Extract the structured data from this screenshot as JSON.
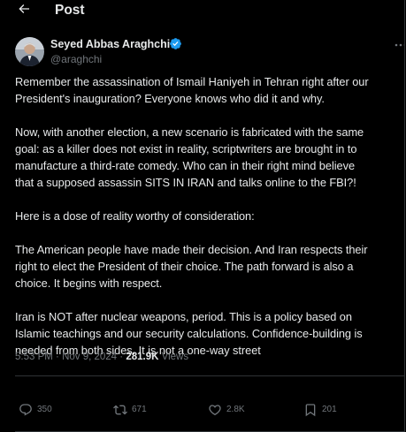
{
  "header": {
    "title": "Post"
  },
  "author": {
    "name": "Seyed Abbas Araghchi",
    "handle": "@araghchi"
  },
  "tweet": {
    "paragraphs": [
      [
        "Remember the assassination of Ismail Haniyeh in Tehran right after our",
        "President's inauguration? Everyone knows who did it and why."
      ],
      [
        "Now, with another election, a new scenario is fabricated with the same",
        "goal: as a killer does not exist in reality, scriptwriters are brought in to",
        "manufacture a third-rate comedy. Who can in their right mind believe",
        "that a supposed assassin SITS IN IRAN and talks online to the FBI?!"
      ],
      [
        "Here is a dose of reality worthy of consideration:"
      ],
      [
        "The American people have made their decision. And Iran respects their",
        "right to elect the President of their choice. The path forward is also a",
        "choice. It begins with respect."
      ],
      [
        "Iran is NOT after nuclear weapons, period. This is a policy based on",
        "Islamic teachings and our security calculations. Confidence-building is",
        "needed from both sides. It is not a one-way street"
      ]
    ]
  },
  "meta": {
    "time": "5:53 PM",
    "separator": " · ",
    "date": "Nov 9, 2024",
    "views_count": "281.9K",
    "views_label": "Views"
  },
  "actions": {
    "replies": "350",
    "reposts": "671",
    "likes": "2.8K",
    "bookmarks": "201"
  },
  "colors": {
    "background": "#000000",
    "text": "#e7e9ea",
    "muted": "#71767b",
    "border": "#2f3336",
    "verified": "#1d9bf0"
  },
  "icons": {
    "back": "arrow-left-icon",
    "verified": "verified-badge-icon",
    "more": "more-icon",
    "reply": "reply-icon",
    "repost": "repost-icon",
    "like": "heart-icon",
    "bookmark": "bookmark-icon"
  }
}
